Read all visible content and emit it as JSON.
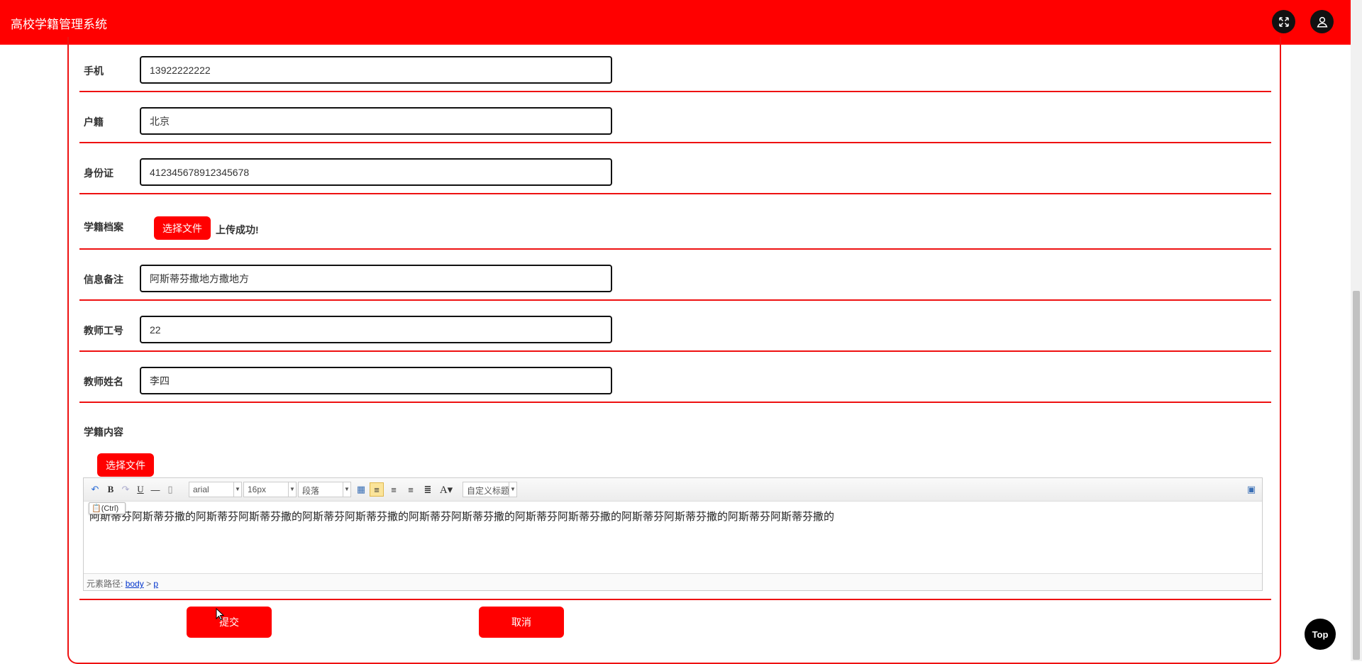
{
  "header": {
    "title": "高校学籍管理系统",
    "fullscreen_icon": "fullscreen-icon",
    "user_icon": "user-icon"
  },
  "form": {
    "phone": {
      "label": "手机",
      "value": "13922222222"
    },
    "household": {
      "label": "户籍",
      "value": "北京"
    },
    "id_card": {
      "label": "身份证",
      "value": "412345678912345678"
    },
    "archive": {
      "label": "学籍档案",
      "button": "选择文件",
      "status": "上传成功!"
    },
    "remark": {
      "label": "信息备注",
      "value": "阿斯蒂芬撒地方撒地方"
    },
    "teacher_id": {
      "label": "教师工号",
      "value": "22"
    },
    "teacher_name": {
      "label": "教师姓名",
      "value": "李四"
    },
    "content": {
      "label": "学籍内容",
      "button": "选择文件"
    }
  },
  "editor": {
    "font_family": "arial",
    "font_size": "16px",
    "paragraph": "段落",
    "custom_title": "自定义标题",
    "text": "阿斯蒂芬阿斯蒂芬撒的阿斯蒂芬阿斯蒂芬撒的阿斯蒂芬阿斯蒂芬撒的阿斯蒂芬阿斯蒂芬撒的阿斯蒂芬阿斯蒂芬撒的阿斯蒂芬阿斯蒂芬撒的阿斯蒂芬阿斯蒂芬撒的",
    "paste_label": "(Ctrl)",
    "path_label": "元素路径:",
    "path_body": "body",
    "path_sep": ">",
    "path_p": "p"
  },
  "actions": {
    "submit": "提交",
    "cancel": "取消",
    "top": "Top"
  },
  "colors": {
    "primary": "#ff0000",
    "border": "#ee1111"
  }
}
